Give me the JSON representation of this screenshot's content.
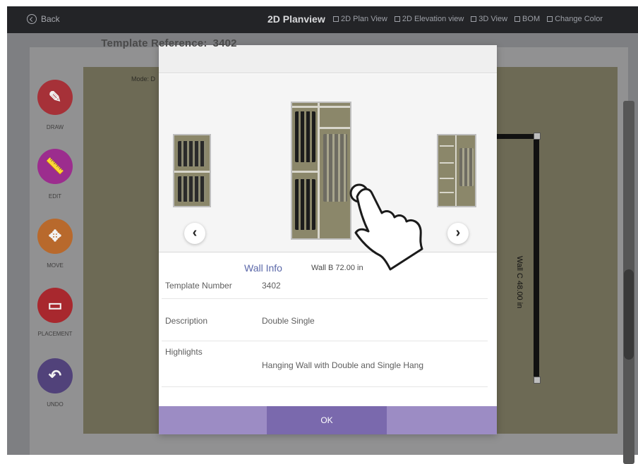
{
  "topbar": {
    "back_label": "Back",
    "title": "2D Planview",
    "nav": [
      {
        "label": "2D Plan View",
        "icon": "plan-icon"
      },
      {
        "label": "2D Elevation view",
        "icon": "elevation-icon"
      },
      {
        "label": "3D View",
        "icon": "cube-icon"
      },
      {
        "label": "BOM",
        "icon": "document-icon"
      },
      {
        "label": "Change Color",
        "icon": "palette-icon"
      }
    ]
  },
  "sidebar": {
    "tools": [
      {
        "label": "DRAW",
        "icon": "pencil-icon"
      },
      {
        "label": "EDIT",
        "icon": "ruler-icon"
      },
      {
        "label": "MOVE",
        "icon": "move-icon"
      },
      {
        "label": "PLACEMENT",
        "icon": "placement-icon"
      },
      {
        "label": "UNDO",
        "icon": "undo-icon"
      }
    ]
  },
  "canvas": {
    "mode_text": "Mode: D",
    "wall_c_label": "Wall C 48.00 in"
  },
  "modal": {
    "template_ref_label": "Template Reference:",
    "template_ref_value": "3402",
    "wall_info_title": "Wall Info",
    "wall_info_value": "Wall B 72.00 in",
    "rows": [
      {
        "label": "Template Number",
        "value": "3402"
      },
      {
        "label": "Description",
        "value": "Double Single"
      },
      {
        "label": "Highlights",
        "value": "Hanging Wall with Double and Single Hang"
      }
    ],
    "ok_label": "OK"
  },
  "colors": {
    "topbar_bg": "#232427",
    "canvas_bg": "#6d6a55",
    "draw": "#a63138",
    "edit": "#9c2d8e",
    "move": "#b8692c",
    "placement": "#a8282e",
    "undo": "#51427a",
    "modal_footer": "#9c8cc4",
    "ok_button": "#7a69ad",
    "wall_info_title": "#5b68a9"
  }
}
